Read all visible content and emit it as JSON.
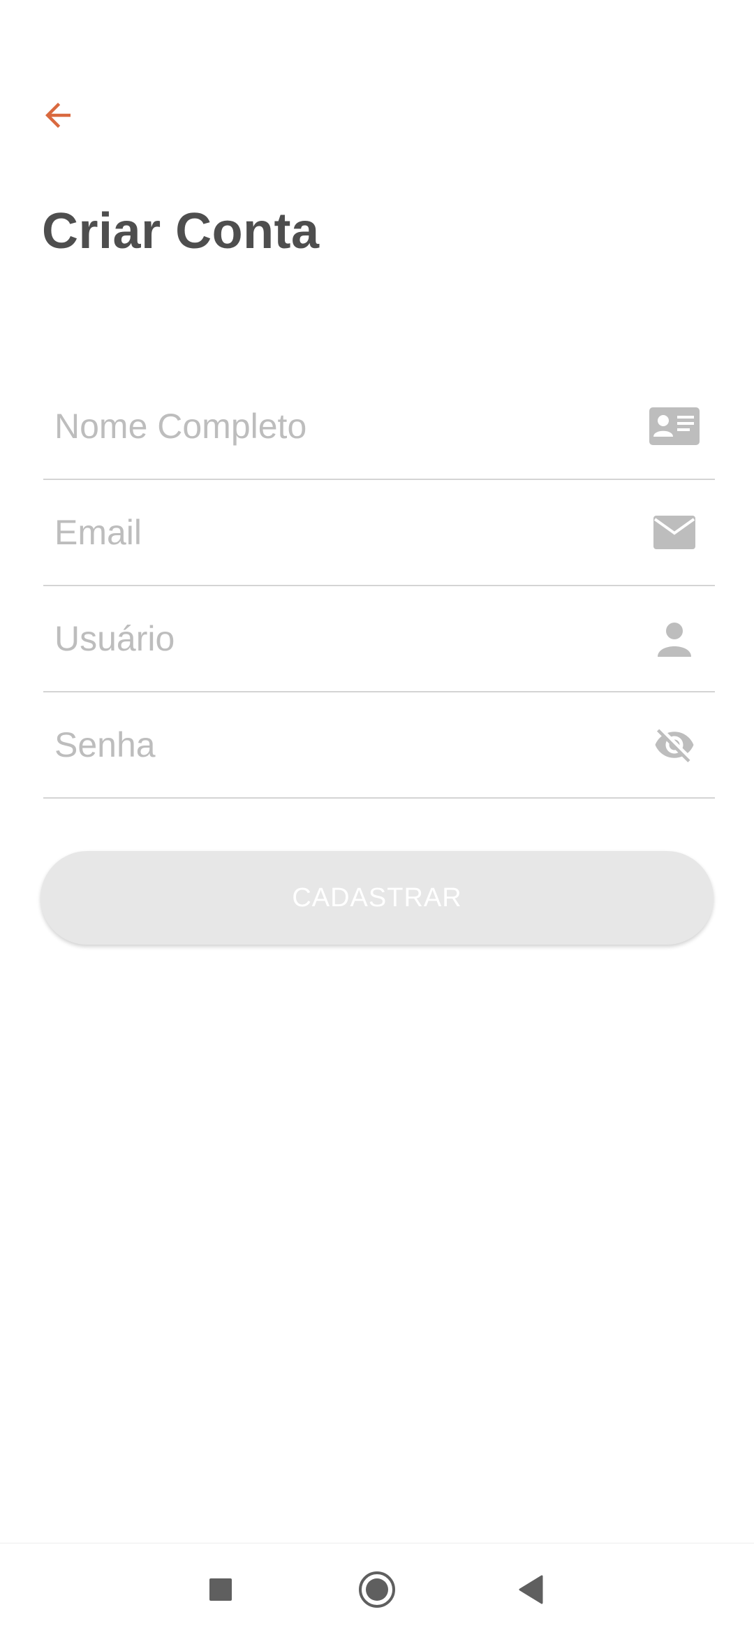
{
  "header": {
    "back_icon": "arrow-left-icon",
    "title": "Criar Conta"
  },
  "form": {
    "full_name": {
      "placeholder": "Nome Completo",
      "value": "",
      "icon": "id-card-icon"
    },
    "email": {
      "placeholder": "Email",
      "value": "",
      "icon": "envelope-icon"
    },
    "username": {
      "placeholder": "Usuário",
      "value": "",
      "icon": "person-icon"
    },
    "password": {
      "placeholder": "Senha",
      "value": "",
      "icon": "eye-off-icon"
    }
  },
  "submit": {
    "label": "CADASTRAR",
    "enabled": false
  },
  "nav": {
    "recents_icon": "square-icon",
    "home_icon": "circle-icon",
    "back_icon": "triangle-back-icon"
  },
  "colors": {
    "accent": "#d9693f",
    "title": "#4e4e4e",
    "placeholder": "#bdbdbd",
    "icon": "#bdbdbd",
    "divider": "#d4d4d4",
    "button_disabled_bg": "#e7e7e7",
    "button_text": "#ffffff",
    "nav_icon": "#5f5f5f"
  }
}
